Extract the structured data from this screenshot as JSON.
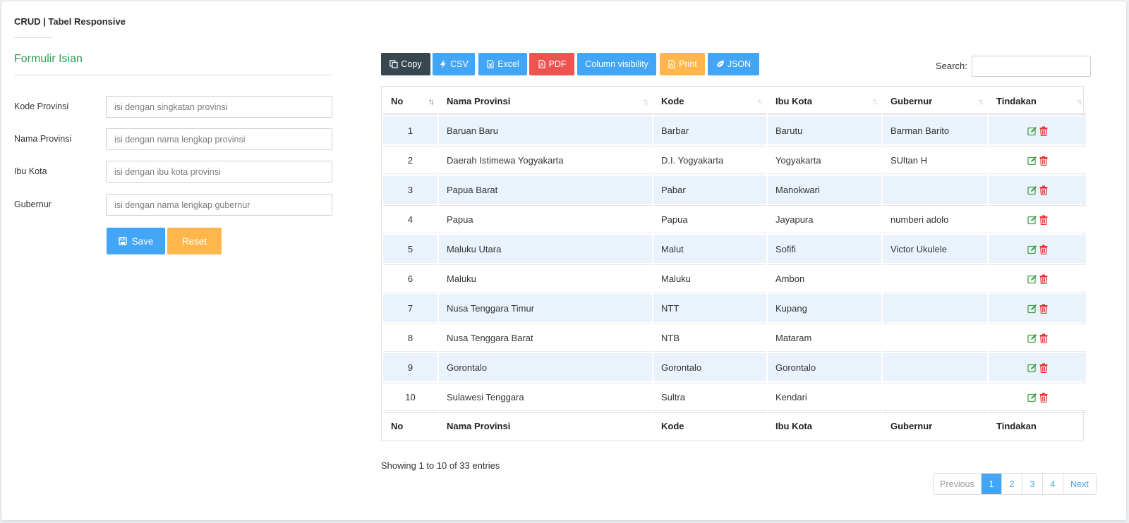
{
  "app": {
    "title": "CRUD | Tabel Responsive"
  },
  "form": {
    "heading": "Formulir Isian",
    "fields": [
      {
        "label": "Kode Provinsi",
        "value": "",
        "placeholder": "isi dengan singkatan provinsi"
      },
      {
        "label": "Nama Provinsi",
        "value": "",
        "placeholder": "isi dengan nama lengkap provinsi"
      },
      {
        "label": "Ibu Kota",
        "value": "",
        "placeholder": "isi dengan ibu kota provinsi"
      },
      {
        "label": "Gubernur",
        "value": "",
        "placeholder": "isi dengan nama lengkap gubernur"
      }
    ],
    "save_label": "Save",
    "reset_label": "Reset"
  },
  "toolbar": {
    "buttons": [
      "Copy",
      "CSV",
      "Excel",
      "PDF",
      "Column visibility",
      "Print",
      "JSON"
    ]
  },
  "search": {
    "label": "Search:",
    "value": "",
    "placeholder": ""
  },
  "table": {
    "columns": [
      "No",
      "Nama Provinsi",
      "Kode",
      "Ibu Kota",
      "Gubernur",
      "Tindakan"
    ],
    "rows": [
      [
        "1",
        "Baruan Baru",
        "Barbar",
        "Barutu",
        "Barman Barito"
      ],
      [
        "2",
        "Daerah Istimewa Yogyakarta",
        "D.I. Yogyakarta",
        "Yogyakarta",
        "SUltan H"
      ],
      [
        "3",
        "Papua Barat",
        "Pabar",
        "Manokwari",
        ""
      ],
      [
        "4",
        "Papua",
        "Papua",
        "Jayapura",
        "numberi adolo"
      ],
      [
        "5",
        "Maluku Utara",
        "Malut",
        "Sofifi",
        "Victor Ukulele"
      ],
      [
        "6",
        "Maluku",
        "Maluku",
        "Ambon",
        ""
      ],
      [
        "7",
        "Nusa Tenggara Timur",
        "NTT",
        "Kupang",
        ""
      ],
      [
        "8",
        "Nusa Tenggara Barat",
        "NTB",
        "Mataram",
        ""
      ],
      [
        "9",
        "Gorontalo",
        "Gorontalo",
        "Gorontalo",
        ""
      ],
      [
        "10",
        "Sulawesi Tenggara",
        "Sultra",
        "Kendari",
        ""
      ]
    ]
  },
  "info": "Showing 1 to 10 of 33 entries",
  "pagination": {
    "previous": "Previous",
    "pages": [
      "1",
      "2",
      "3",
      "4"
    ],
    "active": "1",
    "next": "Next"
  },
  "colors": {
    "primary": "#42a5f5",
    "warning": "#ffb74d",
    "danger": "#ef5350",
    "dark": "#37474f",
    "success": "#2e9e55",
    "stripe": "#eaf3fc"
  },
  "icons": {
    "copy": "copy-icon",
    "csv": "bolt-icon",
    "excel": "file-excel-icon",
    "pdf": "file-pdf-icon",
    "print": "file-print-icon",
    "json": "leaf-icon",
    "save": "floppy-icon",
    "edit": "edit-icon",
    "delete": "trash-icon",
    "sort": "sort-icon"
  }
}
